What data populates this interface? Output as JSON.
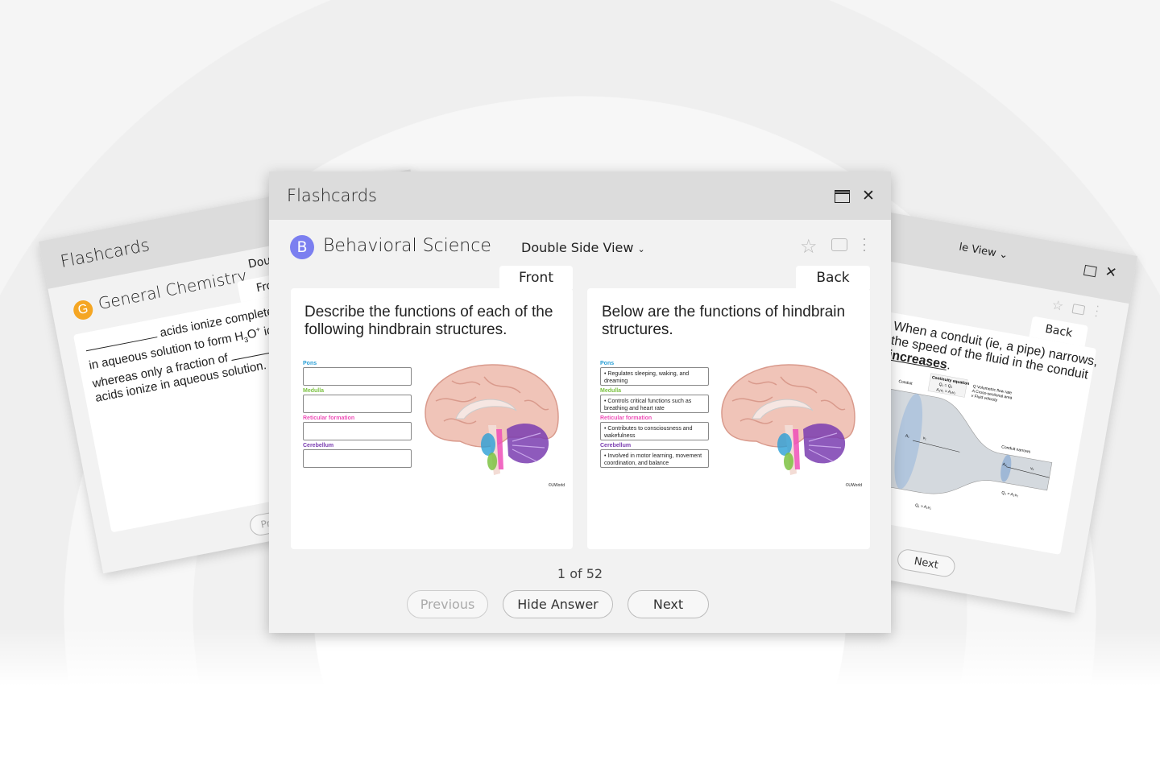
{
  "left_card": {
    "window_title": "Flashcards",
    "deck_initial": "G",
    "deck_name": "General Chemistry",
    "view_mode": "Double Si",
    "tab": "Front",
    "question_line1": "acids ionize completely",
    "question_line2a": "in aqueous solution to form H",
    "question_sub": "3",
    "question_line2b": "O",
    "question_sup": "+",
    "question_line2c": " ions",
    "question_line3": "whereas only a fraction of",
    "question_line4": "acids ionize in aqueous solution.",
    "prev_label": "Previous",
    "deck_color": "#f5a623"
  },
  "main_card": {
    "window_title": "Flashcards",
    "deck_initial": "B",
    "deck_name": "Behavioral Science",
    "deck_color": "#7b7ff0",
    "view_mode": "Double Side View",
    "front": {
      "tab": "Front",
      "question": "Describe the functions of each of the following hindbrain structures.",
      "labels": [
        {
          "name": "Pons",
          "color": "#2a9fd6"
        },
        {
          "name": "Medulla",
          "color": "#7cc242"
        },
        {
          "name": "Reticular formation",
          "color": "#ee4fb8"
        },
        {
          "name": "Cerebellum",
          "color": "#7a3db0"
        }
      ],
      "credit": "©UWorld"
    },
    "back": {
      "tab": "Back",
      "answer": "Below are the functions of hindbrain structures.",
      "items": [
        "Regulates sleeping, waking, and dreaming",
        "Controls critical functions such as breathing and heart rate",
        "Contributes to consciousness and wakefulness",
        "Involved in motor learning, movement coordination, and balance"
      ],
      "credit": "©UWorld"
    },
    "counter": "1 of 52",
    "prev_label": "Previous",
    "hide_label": "Hide Answer",
    "next_label": "Next"
  },
  "right_card": {
    "view_mode": "le View",
    "tab": "Back",
    "answer_a": "When a conduit (ie, a pipe) narrows,",
    "answer_b": "the speed of the fluid in the conduit",
    "answer_c": "increases",
    "next_label": "Next",
    "diagram": {
      "title": "Continuity equation",
      "eq1": "Q₁ = Q₂",
      "eq2": "A₁v₁ = A₂v₂",
      "legend": [
        "Q  Volumetric flow rate",
        "A  Cross-sectional area",
        "v  Fluid velocity"
      ],
      "conduit": "Conduit",
      "narrows": "Conduit narrows",
      "q1": "Q₁ = A₁v₁",
      "q2": "Q₂ = A₂v₂",
      "a1": "A₁",
      "v1": "v₁",
      "a2": "A₂",
      "v2": "v₂"
    }
  }
}
